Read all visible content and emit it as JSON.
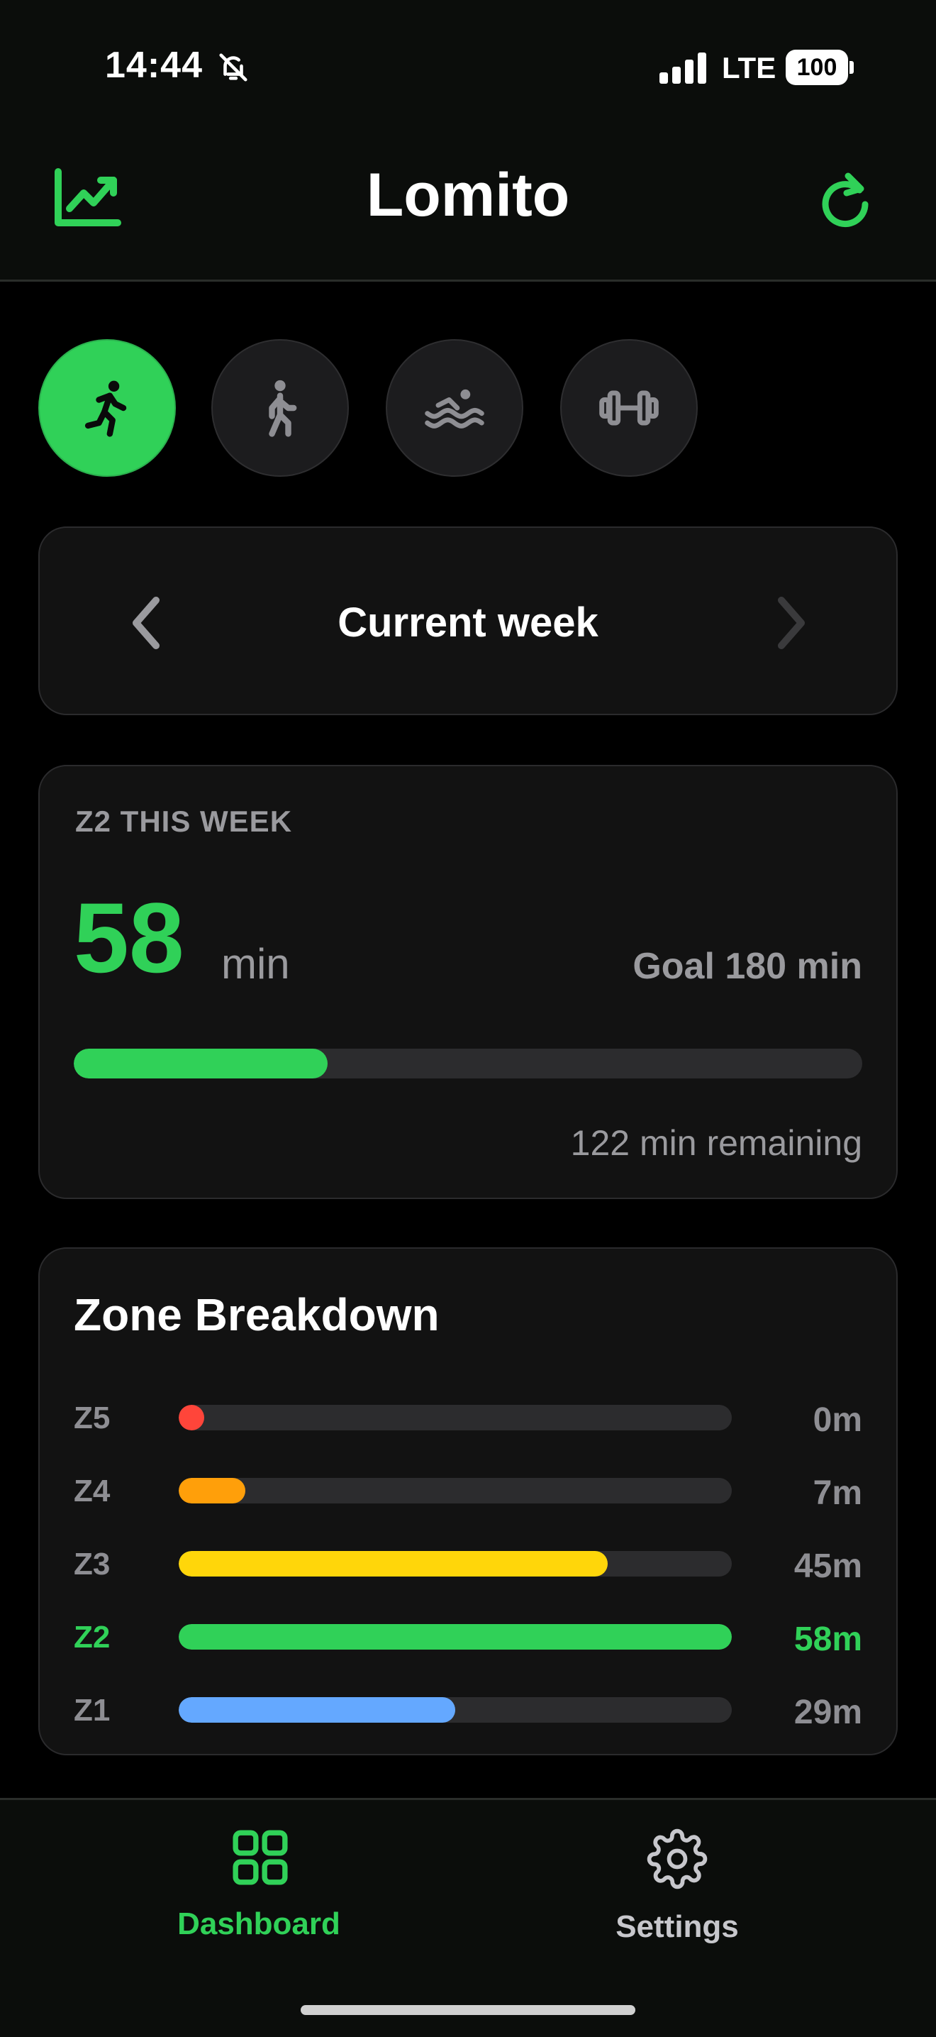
{
  "status_bar": {
    "time": "14:44",
    "network": "LTE",
    "battery": "100",
    "icons": [
      "bell-slash-icon",
      "signal-icon",
      "battery-icon"
    ]
  },
  "header": {
    "title": "Lomito",
    "left_icon": "chart-line-icon",
    "right_icon": "refresh-icon"
  },
  "activities": [
    {
      "icon": "running-icon",
      "selected": true
    },
    {
      "icon": "walking-icon",
      "selected": false
    },
    {
      "icon": "swimming-icon",
      "selected": false
    },
    {
      "icon": "dumbbell-icon",
      "selected": false
    }
  ],
  "week_nav": {
    "label": "Current week",
    "prev_icon": "chevron-left-icon",
    "next_icon": "chevron-right-icon"
  },
  "z2_card": {
    "title": "Z2 THIS WEEK",
    "value": "58",
    "unit": "min",
    "goal": "Goal 180 min",
    "progress_fraction": 0.322,
    "remaining": "122 min remaining"
  },
  "zone_breakdown": {
    "title": "Zone Breakdown",
    "zones": [
      {
        "label": "Z5",
        "value": "0m",
        "fraction": 0.046,
        "color": "#ff453a",
        "highlight": false
      },
      {
        "label": "Z4",
        "value": "7m",
        "fraction": 0.121,
        "color": "#ff9f0a",
        "highlight": false
      },
      {
        "label": "Z3",
        "value": "45m",
        "fraction": 0.776,
        "color": "#ffd60a",
        "highlight": false
      },
      {
        "label": "Z2",
        "value": "58m",
        "fraction": 1.0,
        "color": "#30d158",
        "highlight": true
      },
      {
        "label": "Z1",
        "value": "29m",
        "fraction": 0.5,
        "color": "#64a8ff",
        "highlight": false
      }
    ]
  },
  "tab_bar": {
    "dashboard": {
      "label": "Dashboard",
      "icon": "grid-icon",
      "active": true
    },
    "settings": {
      "label": "Settings",
      "icon": "gear-icon",
      "active": false
    }
  },
  "colors": {
    "accent": "#30d158",
    "background": "#000000",
    "card": "#121212",
    "muted_text": "#9a9a9e"
  }
}
